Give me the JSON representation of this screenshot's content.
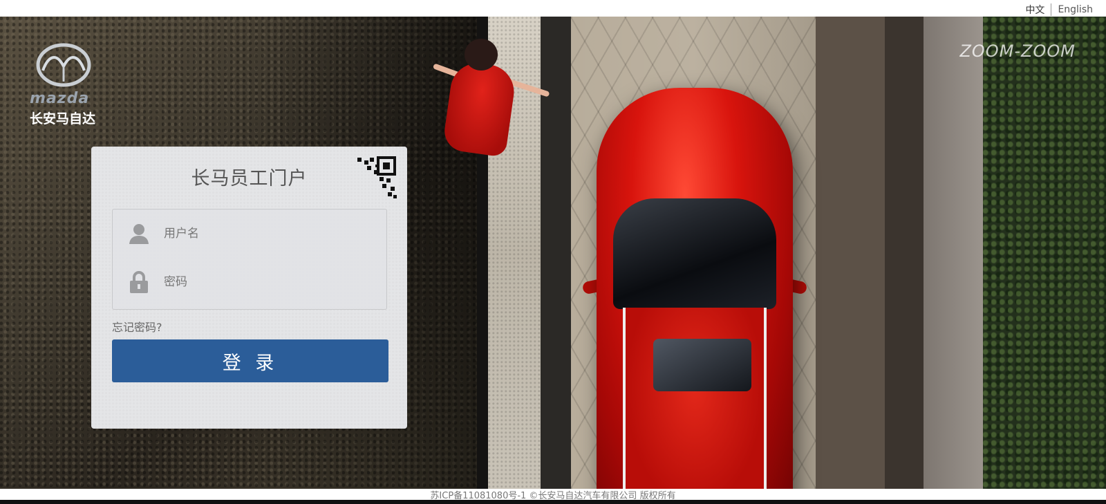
{
  "lang_switch": {
    "zh": "中文",
    "en": "English"
  },
  "brand": {
    "wordmark": "mazda",
    "cn_name": "长安马自达",
    "slogan": "ZOOM-ZOOM"
  },
  "login": {
    "title": "长马员工门户",
    "username_placeholder": "用户名",
    "password_placeholder": "密码",
    "forgot_label": "忘记密码?",
    "submit_label": "登 录"
  },
  "footer": {
    "text": "苏ICP备11081080号-1 ©长安马自达汽车有限公司 版权所有"
  },
  "colors": {
    "login_button": "#2b5d99",
    "card_bg": "#e4e5e7",
    "car_red": "#d8140d"
  },
  "icons": {
    "user": "user-icon",
    "lock": "lock-icon",
    "qr": "qr-code-icon",
    "logo": "mazda-emblem-icon"
  }
}
